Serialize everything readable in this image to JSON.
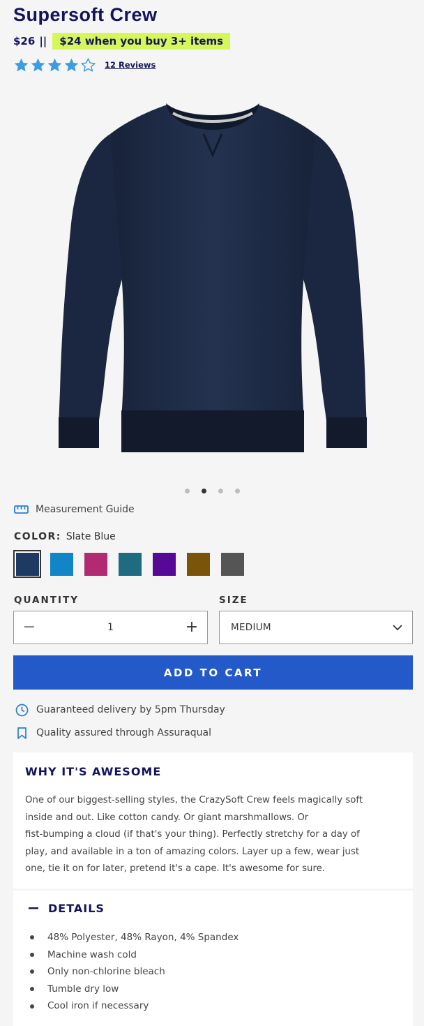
{
  "product": {
    "title": "Supersoft Crew",
    "price": "$26",
    "price_separator": "||",
    "promo": "$24 when you buy 3+ items",
    "rating": 4,
    "rating_max": 5,
    "reviews_link": "12 Reviews"
  },
  "gallery": {
    "image_icon": "sweatshirt-image",
    "image_color": "#1d2a3e",
    "slide_count": 4,
    "active_slide": 2
  },
  "measurement_guide": {
    "icon": "ruler-icon",
    "label": "Measurement Guide"
  },
  "color": {
    "label": "COLOR:",
    "value": "Slate Blue",
    "swatches": [
      "#1d3a63",
      "#1185c7",
      "#b22b72",
      "#1f6b80",
      "#570896",
      "#7a5408",
      "#555555"
    ],
    "selected_index": 0
  },
  "quantity": {
    "label": "QUANTITY",
    "minus": "−",
    "value": "1",
    "plus": "+"
  },
  "size": {
    "label": "SIZE",
    "value": "MEDIUM",
    "icon": "chevron-down-icon"
  },
  "cart": {
    "button_label": "ADD TO CART",
    "color": "#2359c9"
  },
  "info": {
    "delivery": "Guaranteed delivery by 5pm Thursday",
    "quality": "Quality assured through Assuraqual"
  },
  "awesome": {
    "title": "WHY IT'S AWESOME",
    "lines": [
      "One of our biggest-selling styles, the CrazySoft Crew feels magically soft",
      "inside and out. Like cotton candy. Or giant marshmallows. Or",
      "fist-bumping a cloud (if that's your thing). Perfectly stretchy for a day of",
      "play, and available in a ton of amazing colors. Layer up a few, wear just",
      "one, tie it on for later, pretend it's a cape. It's awesome for sure."
    ]
  },
  "details": {
    "title": "DETAILS",
    "toggle_icon": "minus-icon",
    "items": [
      "48% Polyester, 48% Rayon, 4% Spandex",
      "Machine wash cold",
      "Only non-chlorine bleach",
      "Tumble dry low",
      "Cool iron if necessary"
    ]
  }
}
